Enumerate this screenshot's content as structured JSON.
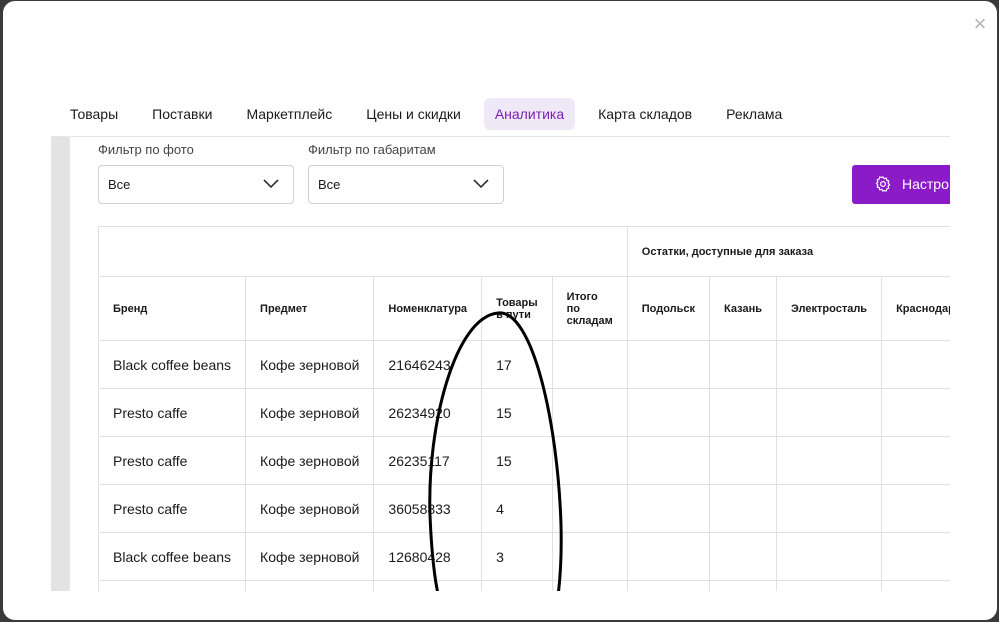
{
  "close_label": "×",
  "tabs": [
    {
      "label": "Товары",
      "active": false
    },
    {
      "label": "Поставки",
      "active": false
    },
    {
      "label": "Маркетплейс",
      "active": false
    },
    {
      "label": "Цены и скидки",
      "active": false
    },
    {
      "label": "Аналитика",
      "active": true
    },
    {
      "label": "Карта складов",
      "active": false
    },
    {
      "label": "Реклама",
      "active": false
    }
  ],
  "filters": {
    "photo": {
      "label": "Фильтр по фото",
      "value": "Все"
    },
    "dimensions": {
      "label": "Фильтр по габаритам",
      "value": "Все"
    }
  },
  "settings_button": {
    "label": "Настро"
  },
  "table": {
    "group_header": "Остатки, доступные для заказа",
    "columns": [
      "Бренд",
      "Предмет",
      "Номенклатура",
      "Товары в пути",
      "Итого по складам",
      "Подольск",
      "Казань",
      "Электросталь",
      "Краснодар"
    ],
    "rows": [
      [
        "Black coffee beans",
        "Кофе зерновой",
        "21646243",
        "17",
        "",
        "",
        "",
        "",
        ""
      ],
      [
        "Presto caffe",
        "Кофе зерновой",
        "26234920",
        "15",
        "",
        "",
        "",
        "",
        ""
      ],
      [
        "Presto caffe",
        "Кофе зерновой",
        "26235117",
        "15",
        "",
        "",
        "",
        "",
        ""
      ],
      [
        "Presto caffe",
        "Кофе зерновой",
        "36058833",
        "4",
        "",
        "",
        "",
        "",
        ""
      ],
      [
        "Black coffee beans",
        "Кофе зерновой",
        "12680428",
        "3",
        "",
        "",
        "",
        "",
        ""
      ],
      [
        "",
        "",
        "",
        "",
        "",
        "",
        "",
        "",
        ""
      ]
    ]
  },
  "colors": {
    "accent": "#8b1ac9",
    "active_tab_bg": "#efe8f6",
    "active_tab_text": "#7a1fb5"
  }
}
